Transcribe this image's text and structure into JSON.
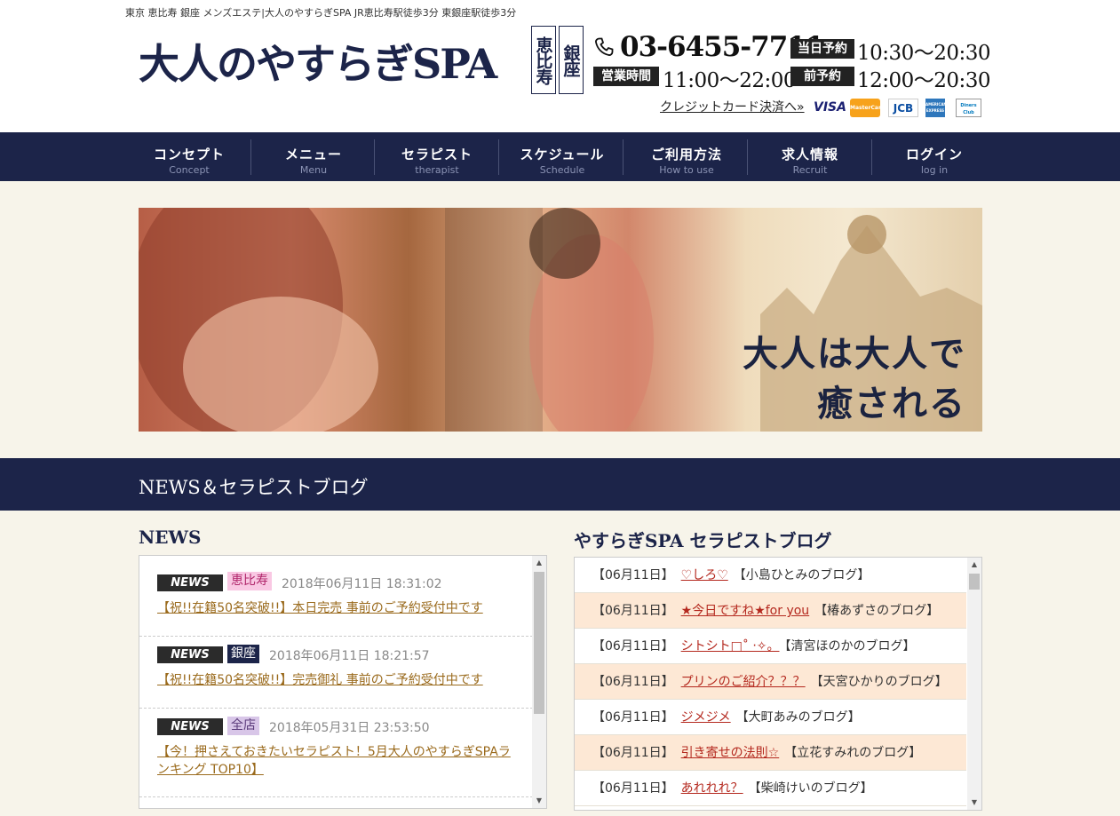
{
  "header": {
    "tagline": "東京 恵比寿 銀座 メンズエステ|大人のやすらぎSPA JR恵比寿駅徒歩3分 東銀座駅徒歩3分",
    "logo": "大人のやすらぎSPA",
    "locations": [
      "恵比寿",
      "銀座"
    ],
    "phone": "03-6455-7711",
    "hours": [
      {
        "label": "当日予約",
        "time": "10:30〜20:30"
      },
      {
        "label": "営業時間",
        "time": "11:00〜22:00"
      },
      {
        "label": "前予約",
        "time": "12:00〜20:30"
      }
    ],
    "credit_link": "クレジットカード決済へ»",
    "cards": [
      "VISA",
      "MasterCard",
      "JCB",
      "AMERICAN EXPRESS",
      "Diners Club"
    ]
  },
  "nav": [
    {
      "jp": "コンセプト",
      "en": "Concept"
    },
    {
      "jp": "メニュー",
      "en": "Menu"
    },
    {
      "jp": "セラピスト",
      "en": "therapist"
    },
    {
      "jp": "スケジュール",
      "en": "Schedule"
    },
    {
      "jp": "ご利用方法",
      "en": "How to use"
    },
    {
      "jp": "求人情報",
      "en": "Recruit"
    },
    {
      "jp": "ログイン",
      "en": "log in"
    }
  ],
  "banner": {
    "line1": "大人は大人で",
    "line2": "癒される"
  },
  "section_title": "NEWS＆セラピストブログ",
  "news": {
    "title": "NEWS",
    "items": [
      {
        "tag": "NEWS",
        "location": "恵比寿",
        "date": "2018年06月11日 18:31:02",
        "text": "【祝!!在籍50名突破!!】本日完売 事前のご予約受付中です"
      },
      {
        "tag": "NEWS",
        "location": "銀座",
        "date": "2018年06月11日 18:21:57",
        "text": "【祝!!在籍50名突破!!】完売御礼 事前のご予約受付中です"
      },
      {
        "tag": "NEWS",
        "location": "全店",
        "date": "2018年05月31日 23:53:50",
        "text": "【今！押さえておきたいセラピスト！5月大人のやすらぎSPAランキング TOP10】"
      }
    ]
  },
  "blog": {
    "title": "やすらぎSPA セラピストブログ",
    "items": [
      {
        "date": "【06月11日】",
        "title": "♡しろ♡",
        "author": "【小島ひとみのブログ】"
      },
      {
        "date": "【06月11日】",
        "title": "★今日ですね★for you",
        "author": "【椿あずさのブログ】"
      },
      {
        "date": "【06月11日】",
        "title": "シトシト□˚ ‧✧。",
        "author": "【清宮ほのかのブログ】"
      },
      {
        "date": "【06月11日】",
        "title": "プリンのご紹介？？？",
        "author": "【天宮ひかりのブログ】"
      },
      {
        "date": "【06月11日】",
        "title": "ジメジメ",
        "author": "【大町あみのブログ】"
      },
      {
        "date": "【06月11日】",
        "title": "引き寄せの法則☆",
        "author": "【立花すみれのブログ】"
      },
      {
        "date": "【06月11日】",
        "title": "あれれれ？",
        "author": "【柴崎けいのブログ】"
      }
    ]
  },
  "colors": {
    "navy": "#1c2449",
    "cream": "#f7f4ea",
    "blog_alt": "#fde8d5",
    "news_link": "#9a6a1c",
    "blog_link": "#b4281e"
  }
}
